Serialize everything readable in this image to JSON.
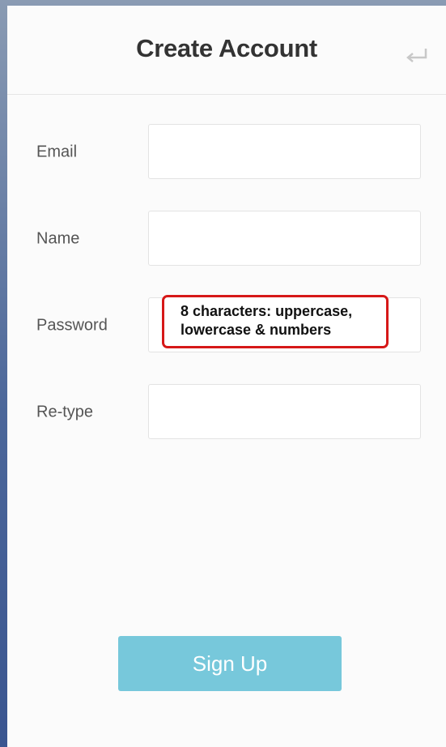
{
  "header": {
    "title": "Create Account",
    "back_icon": "return-arrow-icon"
  },
  "form": {
    "fields": [
      {
        "label": "Email",
        "value": ""
      },
      {
        "label": "Name",
        "value": ""
      },
      {
        "label": "Password",
        "value": ""
      },
      {
        "label": "Re-type",
        "value": ""
      }
    ],
    "password_hint": [
      "8 characters: uppercase,",
      "lowercase & numbers"
    ]
  },
  "signup_button": {
    "label": "Sign Up"
  },
  "colors": {
    "button": "#77c8db",
    "hint_border": "#d61818",
    "background": "#fbfbfb"
  }
}
